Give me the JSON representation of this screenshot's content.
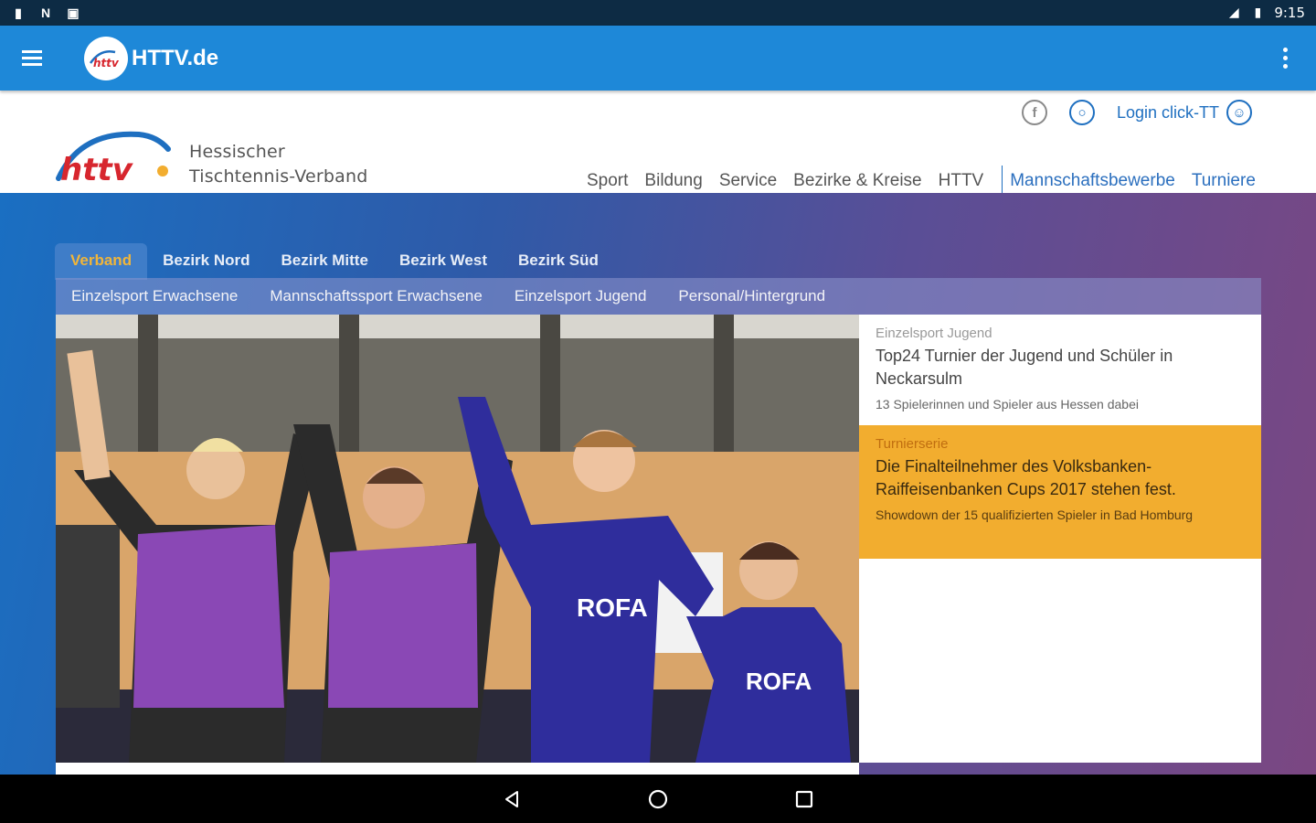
{
  "status_bar": {
    "time": "9:15",
    "icons_left": [
      "sim-icon",
      "notification-n-icon",
      "photo-icon"
    ],
    "icons_right": [
      "signal-icon",
      "battery-icon"
    ]
  },
  "app_bar": {
    "title": "HTTV.de",
    "logo_text": "httv",
    "color": "#1e88d8"
  },
  "header": {
    "logo_text": "httv",
    "org_line1": "Hessischer",
    "org_line2": "Tischtennis-Verband",
    "login_label": "Login click-TT",
    "nav": [
      "Sport",
      "Bildung",
      "Service",
      "Bezirke & Kreise",
      "HTTV"
    ],
    "nav_secondary": [
      "Mannschaftsbewerbe",
      "Turniere"
    ]
  },
  "region_tabs": [
    "Verband",
    "Bezirk Nord",
    "Bezirk Mitte",
    "Bezirk West",
    "Bezirk Süd"
  ],
  "subnav": [
    "Einzelsport Erwachsene",
    "Mannschaftssport Erwachsene",
    "Einzelsport Jugend",
    "Personal/Hintergrund"
  ],
  "news": [
    {
      "category": "Einzelsport Jugend",
      "title": "Top24 Turnier der Jugend und Schüler in Neckarsulm",
      "subtitle": "13 Spielerinnen und Spieler aus Hessen dabei"
    },
    {
      "category": "Turnierserie",
      "title": "Die Finalteilnehmer des Volksbanken-Raiffeisenbanken Cups 2017 stehen fest.",
      "subtitle": "Showdown der 15 qualifizierten Spieler in Bad Homburg"
    }
  ],
  "hero_image": {
    "shirt_text": "ROFA"
  },
  "colors": {
    "accent": "#f2ad2f",
    "link_blue": "#1e6fc0",
    "status_bar": "#0d2b44"
  }
}
